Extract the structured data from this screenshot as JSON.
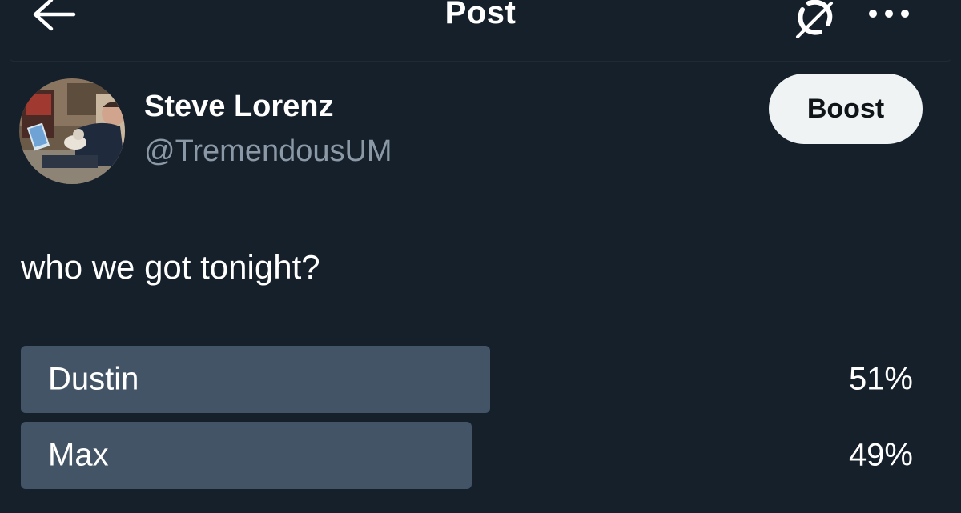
{
  "header": {
    "title": "Post",
    "back_icon": "arrow-left-icon",
    "grok_icon": "grok-icon",
    "more_icon": "more-horizontal-icon"
  },
  "author": {
    "name": "Steve Lorenz",
    "handle": "@TremendousUM",
    "boost_label": "Boost"
  },
  "post": {
    "text": "who we got tonight?"
  },
  "poll": {
    "options": [
      {
        "label": "Dustin",
        "percent": "51%",
        "share": 0.51
      },
      {
        "label": "Max",
        "percent": "49%",
        "share": 0.49
      }
    ]
  },
  "colors": {
    "background": "#15202b",
    "poll_bar": "#425466",
    "handle": "#8b98a5",
    "boost_bg": "#eff3f4"
  }
}
